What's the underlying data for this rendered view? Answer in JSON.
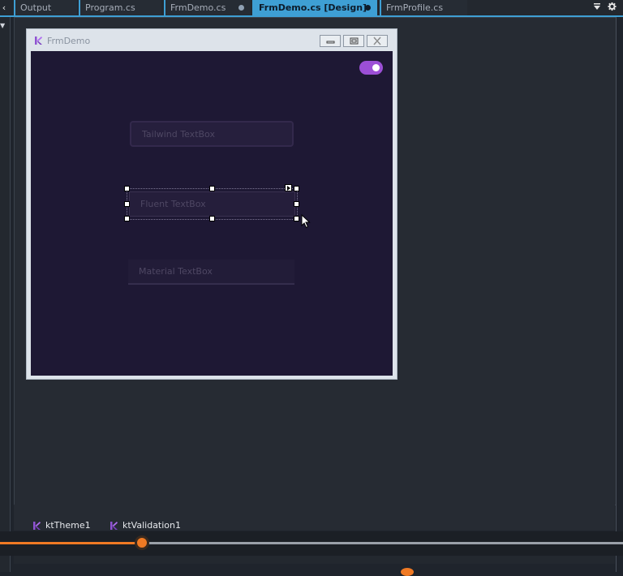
{
  "tabs": [
    {
      "label": "Output",
      "active": false,
      "dot": false
    },
    {
      "label": "Program.cs",
      "active": false,
      "dot": false
    },
    {
      "label": "FrmDemo.cs",
      "active": false,
      "dot": true
    },
    {
      "label": "FrmDemo.cs [Design]",
      "active": true,
      "dot": true
    },
    {
      "label": "FrmProfile.cs",
      "active": false,
      "dot": false
    }
  ],
  "tabstrip_icons": [
    "dropdown-icon",
    "gear-icon"
  ],
  "form": {
    "title": "FrmDemo",
    "toggle_on": true,
    "textboxes": {
      "tailwind": "Tailwind TextBox",
      "fluent": "Fluent TextBox",
      "material": "Material TextBox"
    }
  },
  "tray": {
    "components": [
      "ktTheme1",
      "ktValidation1"
    ]
  },
  "scrubber": {
    "progress": 0.228
  },
  "colors": {
    "accent": "#3e9fd4",
    "form_client": "#1e1834",
    "toggle": "#9c4fd6",
    "scrubber": "#f07a24"
  }
}
